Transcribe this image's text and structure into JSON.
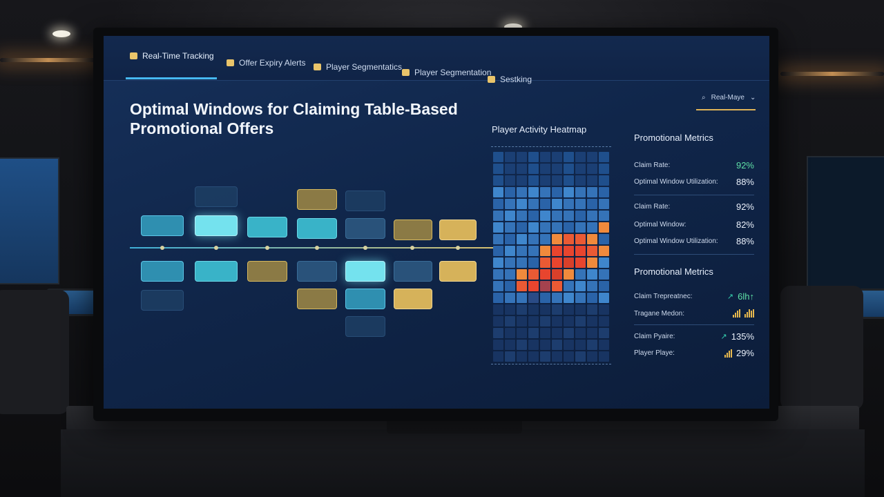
{
  "tabs": [
    {
      "label": "Real-Time Tracking",
      "icon": "tracking-icon",
      "active": true
    },
    {
      "label": "Offer Expiry Alerts",
      "icon": "alert-icon",
      "active": false
    },
    {
      "label": "Player Segmentatics",
      "icon": "segment-icon",
      "active": false
    },
    {
      "label": "Player Segmentation",
      "icon": "users-icon",
      "active": false
    },
    {
      "label": "Sestking",
      "icon": "settings-icon",
      "active": false
    }
  ],
  "top_select": {
    "value": "Real-Maye",
    "icon": "search-icon"
  },
  "page_title": "Optimal Windows for Claiming Table-Based Promotional Offers",
  "heatmap": {
    "title": "Player Activity Heatmap",
    "rows": 18,
    "cols": 10,
    "hot_cells": "center-right cluster of orange and red"
  },
  "metrics_section_1": {
    "title": "Promotional Metrics",
    "rows": [
      {
        "label": "Claim Rate:",
        "value": "92%",
        "accent": true
      },
      {
        "label": "Optimal Window Utilization:",
        "value": "88%"
      }
    ],
    "rows2": [
      {
        "label": "Claim Rate:",
        "value": "92%"
      },
      {
        "label": "Optimal Window:",
        "value": "82%"
      },
      {
        "label": "Optimal Window Utilization:",
        "value": "88%"
      }
    ]
  },
  "metrics_section_2": {
    "title": "Promotional Metrics",
    "rows": [
      {
        "label": "Claim Trepreatnec:",
        "value": "6lh↑"
      },
      {
        "label": "Tragane Medon:",
        "value": ""
      },
      {
        "label": "Claim Pyaire:",
        "value": "135%"
      },
      {
        "label": "Player Playe:",
        "value": "29%"
      }
    ]
  },
  "colors": {
    "accent_green": "#5fe0a6",
    "tab_underline": "#46b8f0",
    "gold": "#e0b458"
  }
}
